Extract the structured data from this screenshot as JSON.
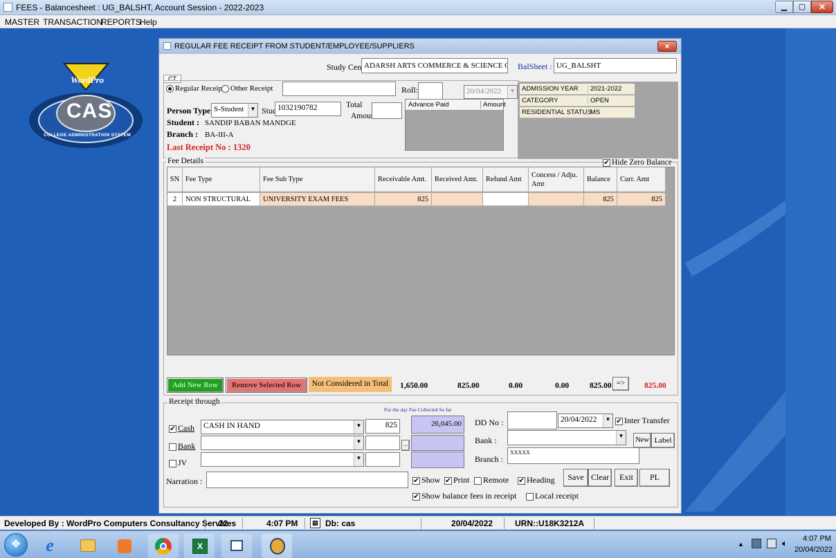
{
  "app": {
    "title": "FEES - Balancesheet : UG_BALSHT, Account Session - 2022-2023",
    "menu": [
      "MASTER",
      "TRANSACTION",
      "REPORTS",
      "Help"
    ]
  },
  "logo": {
    "brand": "WordPro",
    "name": "CAS",
    "tagline": "COLLEGE ADMINISTRATION SYSTEM"
  },
  "dialog": {
    "title": "REGULAR FEE RECEIPT FROM STUDENT/EMPLOYEE/SUPPLIERS",
    "close": "×",
    "study_center_label": "Study Cent",
    "study_center_value": "ADARSH ARTS COMMERCE & SCIENCE CO",
    "balsheet_label": "BalSheet :",
    "balsheet_value": "UG_BALSHT",
    "hidden_tab": "CT",
    "regular_receipt": "Regular Receipt",
    "other_receipt": "Other Receipt",
    "roll_label": "Roll:",
    "roll_value": "",
    "date_value": "20/04/2022",
    "person_type_label": "Person Type",
    "person_type_value": "S-Student",
    "stud_label": "Stud",
    "stud_value": "1032190782",
    "total_label": "Total",
    "amount_label": "Amount",
    "total_amount_value": "",
    "student_label": "Student :",
    "student_value": "SANDIP BABAN MANDGE",
    "branch_label": "Branch :",
    "branch_value": "BA-III-A",
    "last_receipt": "Last Receipt No : 1320",
    "advance_paid": "Advance Paid",
    "advance_amount": "Amount",
    "info_rows": [
      {
        "key": "ADMISSION YEAR",
        "value": "2021-2022"
      },
      {
        "key": "CATEGORY",
        "value": "OPEN"
      },
      {
        "key": "RESIDENTIAL STATUS",
        "value": "MS"
      }
    ]
  },
  "fee_details": {
    "legend": "Fee Details",
    "hide_zero_balance": "Hide Zero Balance",
    "columns": [
      "SN",
      "Fee Type",
      "Fee Sub Type",
      "Receivable Amt.",
      "Received Amt.",
      "Refund Amt",
      "Concess / Adju. Amt",
      "Balance",
      "Curr. Amt"
    ],
    "rows": [
      {
        "sn": "2",
        "fee_type": "NON STRUCTURAL",
        "fee_sub_type": "UNIVERSITY EXAM FEES",
        "receivable": "825",
        "received": "",
        "refund": "",
        "concess": "",
        "balance": "825",
        "curr": "825"
      }
    ]
  },
  "actions": {
    "add_row": "Add New Row",
    "remove_row": "Remove Selected Row",
    "not_considered": "Not Considered in Total",
    "arrow": "=>"
  },
  "totals": {
    "receivable": "1,650.00",
    "received": "825.00",
    "refund": "0.00",
    "concess": "0.00",
    "balance": "825.00",
    "curr": "825.00"
  },
  "receipt": {
    "legend": "Receipt through",
    "collected_label": "For the day Fee Collected So far",
    "cash_label": "Cash",
    "cash_account": "CASH IN HAND",
    "cash_amount": "825",
    "collected_value": "26,045.00",
    "bank_label": "Bank",
    "jv_label": "JV",
    "ellipsis": "...",
    "dd_no_label": "DD No :",
    "dd_date": "20/04/2022",
    "inter_transfer": "Inter Transfer",
    "bank_field_label": "Bank :",
    "new_button": "New",
    "label_button": "Label",
    "branch_label": "Branch :",
    "branch_value": "XXXXX",
    "narration_label": "Narration :",
    "show": "Show",
    "print": "Print",
    "remote": "Remote",
    "heading": "Heading",
    "save": "Save",
    "clear": "Clear",
    "exit": "Exit",
    "pl": "PL",
    "show_balance": "Show balance fees in receipt",
    "local_receipt": "Local receipt"
  },
  "status": {
    "developer": "Developed By : WordPro Computers Consultancy Services",
    "count": "22",
    "time": "4:07 PM",
    "db": "Db: cas",
    "date": "20/04/2022",
    "urn": "URN::U18K3212A"
  },
  "taskbar": {
    "time": "4:07 PM",
    "date": "20/04/2022"
  },
  "colors": {
    "titlebar": "#c4d7ee",
    "dialog_bg": "#f0f0f0",
    "grid_bg": "#a5a5a5",
    "row_highlight": "#f8dcc3",
    "last_receipt": "#d62020",
    "add_row": "#1fa11f",
    "remove_row": "#e57373",
    "not_considered": "#f4be78",
    "collected_field": "#c8c4f4",
    "info_panel": "#f3eedb",
    "desktop": "#1f5fb8"
  }
}
